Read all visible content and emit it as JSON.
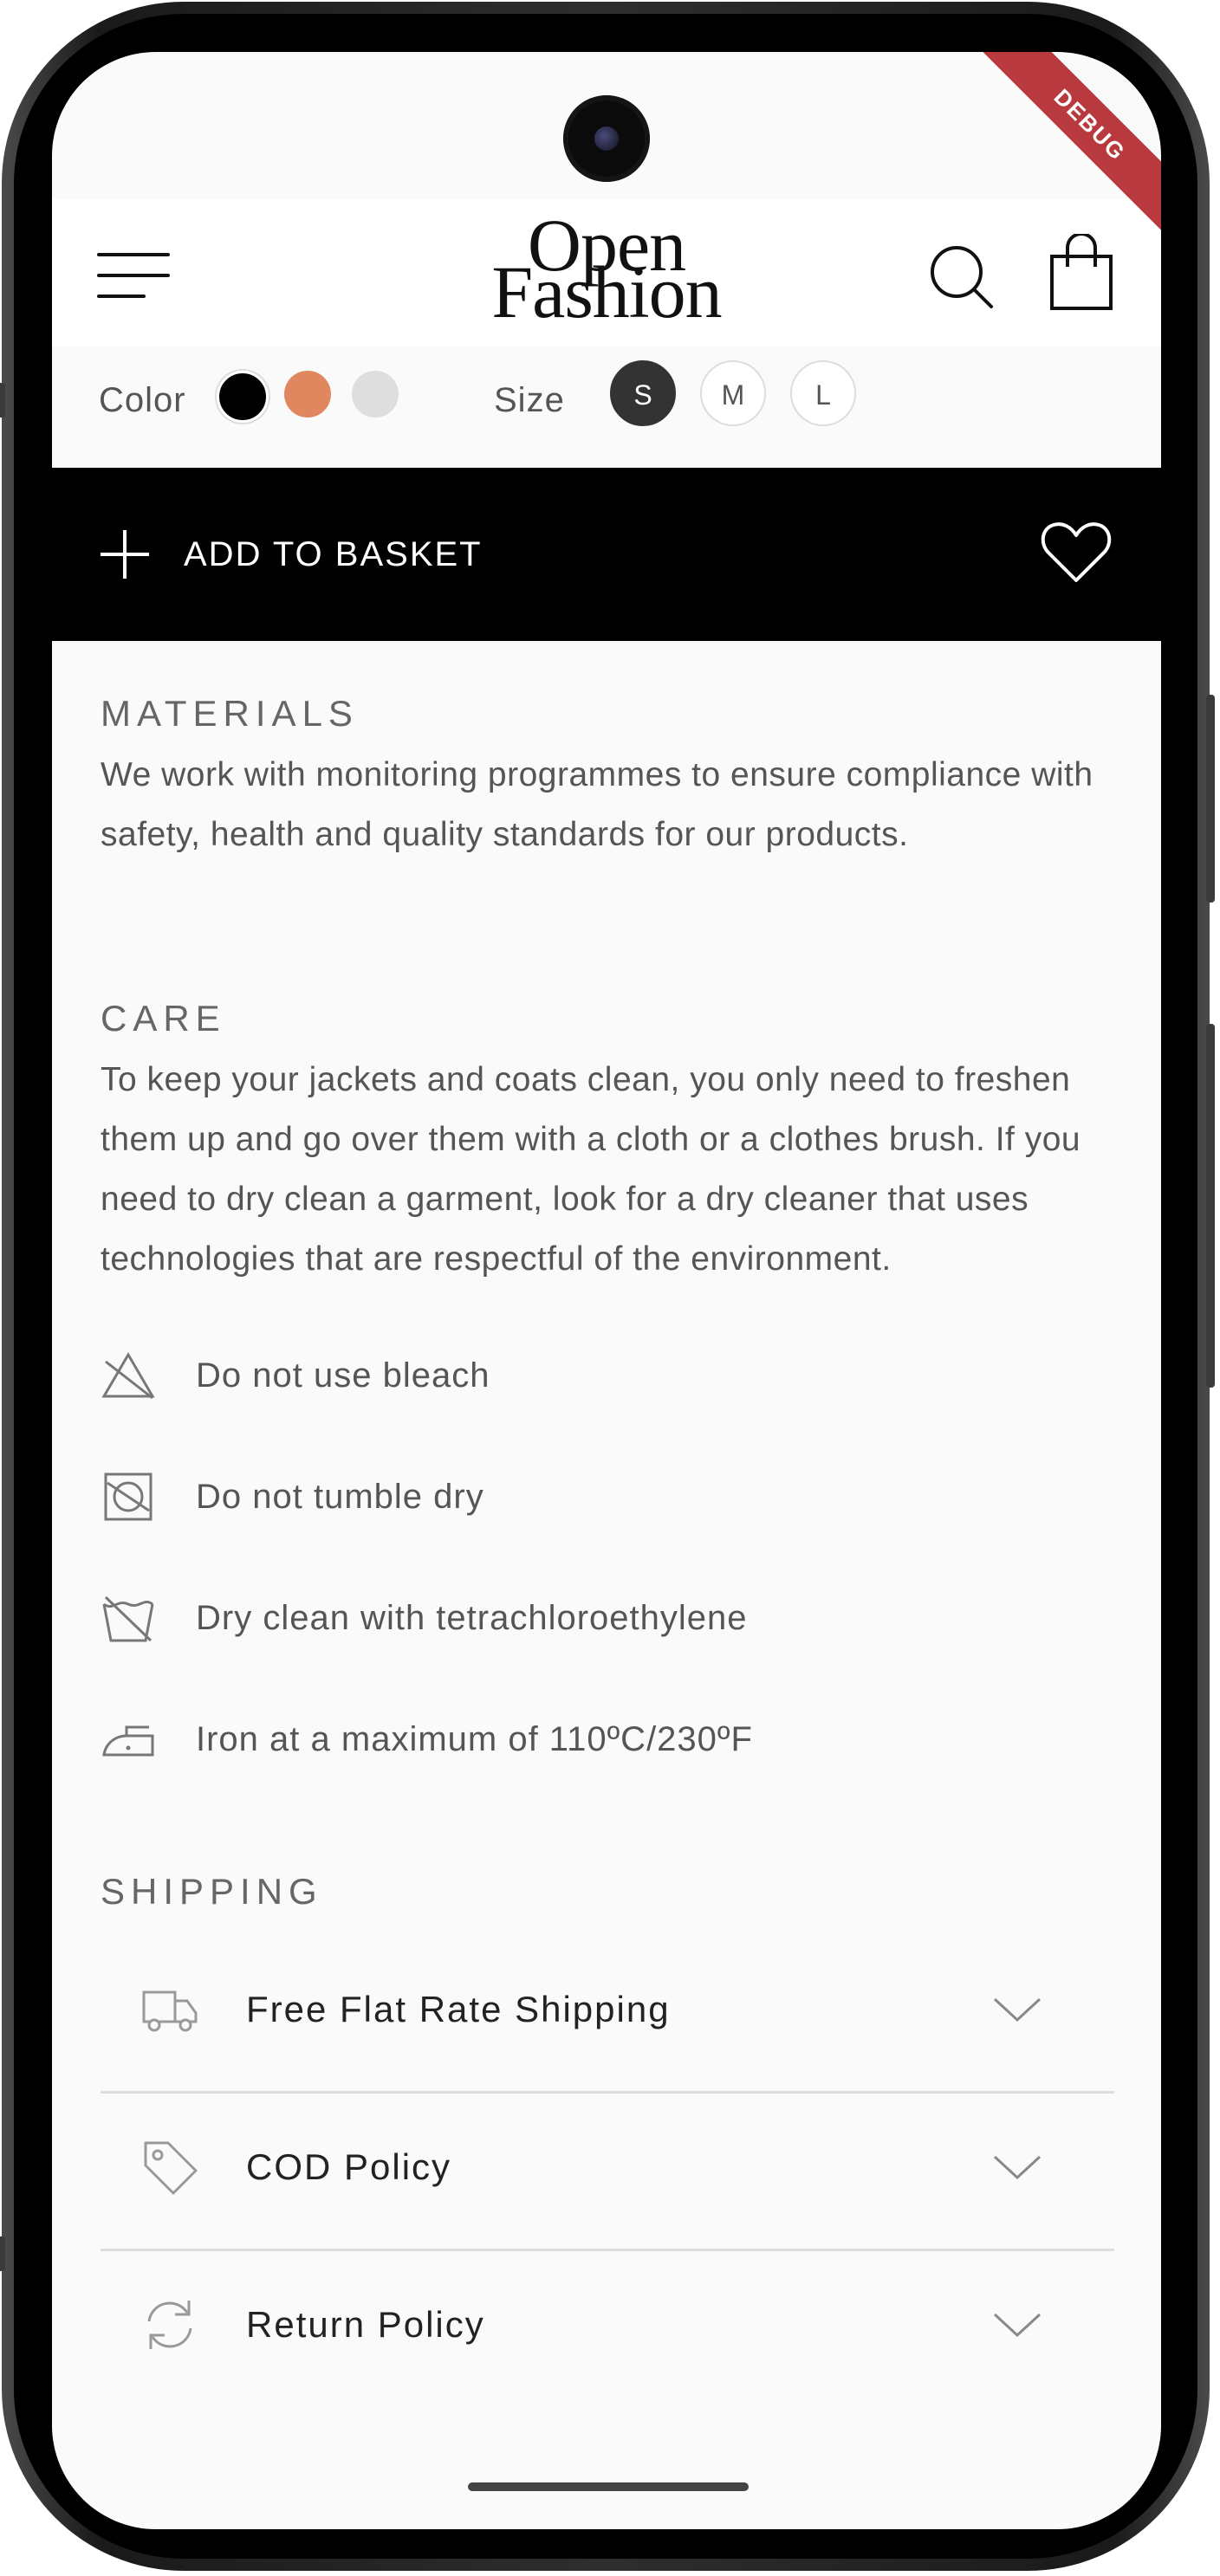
{
  "debug_banner": "DEBUG",
  "header": {
    "logo_line1": "Open",
    "logo_line2": "Fashion",
    "icons": {
      "menu": "menu-icon",
      "search": "search-icon",
      "bag": "shopping-bag-icon"
    }
  },
  "options": {
    "color_label": "Color",
    "colors": [
      "#000000",
      "#E0875F",
      "#DEDEDE"
    ],
    "size_label": "Size",
    "sizes": [
      "S",
      "M",
      "L"
    ],
    "selected_size": "S"
  },
  "basket": {
    "label": "ADD TO BASKET",
    "icons": {
      "add": "plus-icon",
      "favorite": "heart-icon"
    }
  },
  "materials": {
    "title": "MATERIALS",
    "text": "We work with monitoring programmes to ensure compliance with safety, health and quality standards for our products."
  },
  "care": {
    "title": "CARE",
    "text": "To keep your jackets and coats clean, you only need to freshen them up and go over them with a cloth or a clothes brush. If you need to dry clean a garment, look for a dry cleaner that uses technologies that are respectful of the environment.",
    "items": [
      {
        "label": "Do not use bleach",
        "icon": "no-bleach-icon"
      },
      {
        "label": "Do not tumble dry",
        "icon": "no-tumble-dry-icon"
      },
      {
        "label": "Dry clean with tetrachloroethylene",
        "icon": "dry-clean-icon"
      },
      {
        "label": "Iron at a maximum of 110ºC/230ºF",
        "icon": "iron-icon"
      }
    ]
  },
  "shipping": {
    "title": "SHIPPING",
    "items": [
      {
        "label": "Free Flat Rate Shipping",
        "icon": "truck-icon"
      },
      {
        "label": "COD Policy",
        "icon": "tag-icon"
      },
      {
        "label": "Return Policy",
        "icon": "refresh-icon"
      }
    ]
  }
}
